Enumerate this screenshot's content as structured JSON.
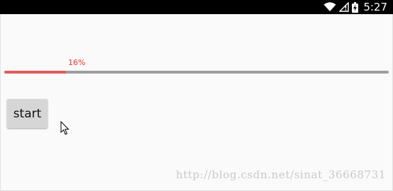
{
  "status_bar": {
    "time": "5:27",
    "icons": [
      "wifi-icon",
      "cellular-no-data-icon",
      "battery-charging-icon"
    ],
    "background": "#000000"
  },
  "progress": {
    "value_percent": 16,
    "label": "16%",
    "fill_color": "#e35b5b",
    "track_color": "#9e9e9e",
    "label_color": "#e53935"
  },
  "start_button": {
    "label": "start"
  },
  "watermark": {
    "text": "http://blog.csdn.net/sinat_36668731"
  }
}
